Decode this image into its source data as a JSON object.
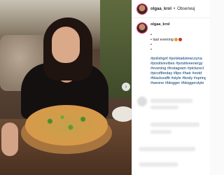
{
  "post": {
    "username": "olgaa_krol",
    "dot": "•",
    "follow_label": "Obserwuj",
    "caption_user": "olgaa_krol",
    "caption_text": "last evening",
    "dots_lines": [
      "•",
      "•",
      "•",
      "•"
    ],
    "hashtag_lines": [
      "#polishgirl #polskadziewczyna",
      "#positivevibes #positiveenergy",
      "#evening #instagram #picturecl",
      "#picoftheday #lips #hair #ootd",
      "#blackoutfit #style #body #spring",
      "#weone #blogger #bloggerstyle"
    ],
    "carousel_next": "›"
  },
  "colors": {
    "link": "#00376b",
    "text": "#262626",
    "border": "#efefef"
  }
}
